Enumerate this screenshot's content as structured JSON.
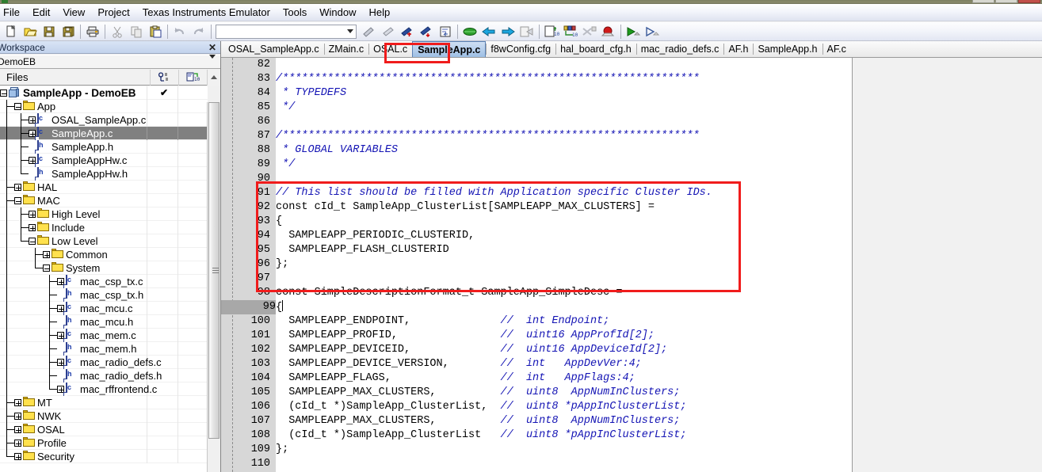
{
  "window": {
    "title_strip": "",
    "controls": [
      "minimize",
      "maximize",
      "close"
    ]
  },
  "menubar": {
    "items": [
      {
        "label": "File",
        "name": "menu-file"
      },
      {
        "label": "Edit",
        "name": "menu-edit"
      },
      {
        "label": "View",
        "name": "menu-view"
      },
      {
        "label": "Project",
        "name": "menu-project"
      },
      {
        "label": "Texas Instruments Emulator",
        "name": "menu-ti-emulator"
      },
      {
        "label": "Tools",
        "name": "menu-tools"
      },
      {
        "label": "Window",
        "name": "menu-window"
      },
      {
        "label": "Help",
        "name": "menu-help"
      }
    ]
  },
  "toolbar": {
    "combo_value": "",
    "combo_placeholder": "",
    "buttons": [
      "new-file-icon",
      "open-folder-icon",
      "save-icon",
      "save-all-icon",
      "print-icon",
      "cut-icon",
      "copy-icon",
      "paste-icon",
      "undo-icon",
      "redo-icon",
      "bookmark-toggle-icon",
      "bookmark-clear-icon",
      "bookmark-next-icon",
      "bookmark-prev-icon",
      "find-in-file-icon",
      "compile-icon",
      "make-icon",
      "make-restore-icon",
      "stop-build-icon",
      "next-statement-icon",
      "find-declaration-icon",
      "find-references-icon",
      "break-all-icon",
      "breakpoint-icon",
      "debug-run-icon",
      "debug-without-download-icon"
    ]
  },
  "workspace": {
    "title": "Workspace",
    "close_label": "✕",
    "config_value": "DemoEB",
    "column_files": "Files",
    "column_icons": [
      "overview-columns-icon",
      "build-columns-icon"
    ],
    "tree": [
      {
        "label": "SampleApp - DemoEB",
        "depth": 0,
        "icon": "project-cube-icon",
        "expander": "minus",
        "checked": "✔",
        "selected": false,
        "bold": true
      },
      {
        "label": "App",
        "depth": 1,
        "icon": "folder-icon",
        "expander": "minus",
        "selected": false
      },
      {
        "label": "OSAL_SampleApp.c",
        "depth": 2,
        "icon": "c-file-icon",
        "expander": "plus",
        "selected": false
      },
      {
        "label": "SampleApp.c",
        "depth": 2,
        "icon": "c-file-icon",
        "expander": "plus",
        "selected": true
      },
      {
        "label": "SampleApp.h",
        "depth": 2,
        "icon": "h-file-icon",
        "expander": "none",
        "selected": false
      },
      {
        "label": "SampleAppHw.c",
        "depth": 2,
        "icon": "c-file-icon",
        "expander": "plus",
        "selected": false
      },
      {
        "label": "SampleAppHw.h",
        "depth": 2,
        "icon": "h-file-icon",
        "expander": "none",
        "selected": false
      },
      {
        "label": "HAL",
        "depth": 1,
        "icon": "folder-icon",
        "expander": "plus",
        "selected": false
      },
      {
        "label": "MAC",
        "depth": 1,
        "icon": "folder-icon",
        "expander": "minus",
        "selected": false
      },
      {
        "label": "High Level",
        "depth": 2,
        "icon": "folder-icon",
        "expander": "plus",
        "selected": false
      },
      {
        "label": "Include",
        "depth": 2,
        "icon": "folder-icon",
        "expander": "plus",
        "selected": false
      },
      {
        "label": "Low Level",
        "depth": 2,
        "icon": "folder-icon",
        "expander": "minus",
        "selected": false
      },
      {
        "label": "Common",
        "depth": 3,
        "icon": "folder-icon",
        "expander": "plus",
        "selected": false
      },
      {
        "label": "System",
        "depth": 3,
        "icon": "folder-icon",
        "expander": "minus",
        "selected": false
      },
      {
        "label": "mac_csp_tx.c",
        "depth": 4,
        "icon": "c-file-icon",
        "expander": "plus",
        "selected": false
      },
      {
        "label": "mac_csp_tx.h",
        "depth": 4,
        "icon": "h-file-icon",
        "expander": "none",
        "selected": false
      },
      {
        "label": "mac_mcu.c",
        "depth": 4,
        "icon": "c-file-icon",
        "expander": "plus",
        "selected": false
      },
      {
        "label": "mac_mcu.h",
        "depth": 4,
        "icon": "h-file-icon",
        "expander": "none",
        "selected": false
      },
      {
        "label": "mac_mem.c",
        "depth": 4,
        "icon": "c-file-icon",
        "expander": "plus",
        "selected": false
      },
      {
        "label": "mac_mem.h",
        "depth": 4,
        "icon": "h-file-icon",
        "expander": "none",
        "selected": false
      },
      {
        "label": "mac_radio_defs.c",
        "depth": 4,
        "icon": "c-file-icon",
        "expander": "plus",
        "selected": false
      },
      {
        "label": "mac_radio_defs.h",
        "depth": 4,
        "icon": "h-file-icon",
        "expander": "none",
        "selected": false
      },
      {
        "label": "mac_rffrontend.c",
        "depth": 4,
        "icon": "c-file-icon",
        "expander": "plus",
        "selected": false
      },
      {
        "label": "MT",
        "depth": 1,
        "icon": "folder-icon",
        "expander": "plus",
        "selected": false
      },
      {
        "label": "NWK",
        "depth": 1,
        "icon": "folder-icon",
        "expander": "plus",
        "selected": false
      },
      {
        "label": "OSAL",
        "depth": 1,
        "icon": "folder-icon",
        "expander": "plus",
        "selected": false
      },
      {
        "label": "Profile",
        "depth": 1,
        "icon": "folder-icon",
        "expander": "plus",
        "selected": false
      },
      {
        "label": "Security",
        "depth": 1,
        "icon": "folder-icon",
        "expander": "plus",
        "selected": false
      }
    ]
  },
  "editor": {
    "tabs": [
      {
        "label": "OSAL_SampleApp.c",
        "active": false
      },
      {
        "label": "ZMain.c",
        "active": false
      },
      {
        "label": "OSAL.c",
        "active": false
      },
      {
        "label": "SampleApp.c",
        "active": true
      },
      {
        "label": "f8wConfig.cfg",
        "active": false
      },
      {
        "label": "hal_board_cfg.h",
        "active": false
      },
      {
        "label": "mac_radio_defs.c",
        "active": false
      },
      {
        "label": "AF.h",
        "active": false
      },
      {
        "label": "SampleApp.h",
        "active": false
      },
      {
        "label": "AF.c",
        "active": false
      }
    ],
    "current_line": 99,
    "highlight_color": "#f01c1c",
    "comment_color": "#1414b4",
    "lines": [
      {
        "n": 82,
        "segments": []
      },
      {
        "n": 83,
        "segments": [
          {
            "t": "/*****************************************************************",
            "c": true
          }
        ]
      },
      {
        "n": 84,
        "segments": [
          {
            "t": " * TYPEDEFS",
            "c": true
          }
        ]
      },
      {
        "n": 85,
        "segments": [
          {
            "t": " */",
            "c": true
          }
        ]
      },
      {
        "n": 86,
        "segments": []
      },
      {
        "n": 87,
        "segments": [
          {
            "t": "/*****************************************************************",
            "c": true
          }
        ]
      },
      {
        "n": 88,
        "segments": [
          {
            "t": " * GLOBAL VARIABLES",
            "c": true
          }
        ]
      },
      {
        "n": 89,
        "segments": [
          {
            "t": " */",
            "c": true
          }
        ]
      },
      {
        "n": 90,
        "segments": []
      },
      {
        "n": 91,
        "segments": [
          {
            "t": "// This list should be filled with Application specific Cluster IDs.",
            "c": true
          }
        ]
      },
      {
        "n": 92,
        "segments": [
          {
            "t": "const cId_t SampleApp_ClusterList[SAMPLEAPP_MAX_CLUSTERS] =",
            "c": false
          }
        ]
      },
      {
        "n": 93,
        "segments": [
          {
            "t": "{",
            "c": false
          }
        ]
      },
      {
        "n": 94,
        "segments": [
          {
            "t": "  SAMPLEAPP_PERIODIC_CLUSTERID,",
            "c": false
          }
        ]
      },
      {
        "n": 95,
        "segments": [
          {
            "t": "  SAMPLEAPP_FLASH_CLUSTERID",
            "c": false
          }
        ]
      },
      {
        "n": 96,
        "segments": [
          {
            "t": "};",
            "c": false
          }
        ]
      },
      {
        "n": 97,
        "segments": []
      },
      {
        "n": 98,
        "segments": [
          {
            "t": "const SimpleDescriptionFormat_t SampleApp_SimpleDesc =",
            "c": false
          }
        ]
      },
      {
        "n": 99,
        "segments": [
          {
            "t": "{",
            "c": false
          }
        ],
        "caret": true
      },
      {
        "n": 100,
        "segments": [
          {
            "t": "  SAMPLEAPP_ENDPOINT,              ",
            "c": false
          },
          {
            "t": "//  int Endpoint;",
            "c": true
          }
        ]
      },
      {
        "n": 101,
        "segments": [
          {
            "t": "  SAMPLEAPP_PROFID,                ",
            "c": false
          },
          {
            "t": "//  uint16 AppProfId[2];",
            "c": true
          }
        ]
      },
      {
        "n": 102,
        "segments": [
          {
            "t": "  SAMPLEAPP_DEVICEID,              ",
            "c": false
          },
          {
            "t": "//  uint16 AppDeviceId[2];",
            "c": true
          }
        ]
      },
      {
        "n": 103,
        "segments": [
          {
            "t": "  SAMPLEAPP_DEVICE_VERSION,        ",
            "c": false
          },
          {
            "t": "//  int   AppDevVer:4;",
            "c": true
          }
        ]
      },
      {
        "n": 104,
        "segments": [
          {
            "t": "  SAMPLEAPP_FLAGS,                 ",
            "c": false
          },
          {
            "t": "//  int   AppFlags:4;",
            "c": true
          }
        ]
      },
      {
        "n": 105,
        "segments": [
          {
            "t": "  SAMPLEAPP_MAX_CLUSTERS,          ",
            "c": false
          },
          {
            "t": "//  uint8  AppNumInClusters;",
            "c": true
          }
        ]
      },
      {
        "n": 106,
        "segments": [
          {
            "t": "  (cId_t *)SampleApp_ClusterList,  ",
            "c": false
          },
          {
            "t": "//  uint8 *pAppInClusterList;",
            "c": true
          }
        ]
      },
      {
        "n": 107,
        "segments": [
          {
            "t": "  SAMPLEAPP_MAX_CLUSTERS,          ",
            "c": false
          },
          {
            "t": "//  uint8  AppNumInClusters;",
            "c": true
          }
        ]
      },
      {
        "n": 108,
        "segments": [
          {
            "t": "  (cId_t *)SampleApp_ClusterList   ",
            "c": false
          },
          {
            "t": "//  uint8 *pAppInClusterList;",
            "c": true
          }
        ]
      },
      {
        "n": 109,
        "segments": [
          {
            "t": "};",
            "c": false
          }
        ]
      },
      {
        "n": 110,
        "segments": []
      }
    ]
  }
}
